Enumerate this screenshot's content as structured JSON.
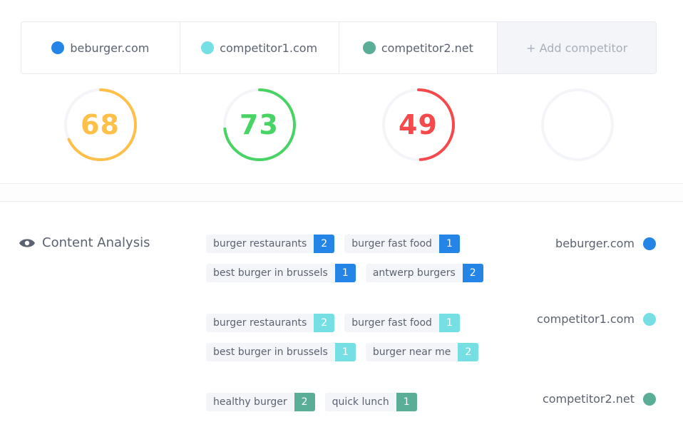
{
  "competitors": [
    {
      "name": "beburger.com",
      "color": "#2585e6",
      "score": 68,
      "score_color": "#ffc04a"
    },
    {
      "name": "competitor1.com",
      "color": "#75dfe4",
      "score": 73,
      "score_color": "#48d465"
    },
    {
      "name": "competitor2.net",
      "color": "#5aad96",
      "score": 49,
      "score_color": "#f5494b"
    }
  ],
  "add_competitor_label": "+ Add competitor",
  "gauge_track_color": "#f4f5f9",
  "content_analysis": {
    "title": "Content Analysis",
    "icon": "eye-icon",
    "groups": [
      {
        "site": "beburger.com",
        "color": "#2585e6",
        "rows": [
          [
            {
              "keyword": "burger restaurants",
              "count": "2"
            },
            {
              "keyword": "burger fast food",
              "count": "1"
            }
          ],
          [
            {
              "keyword": "best burger in brussels",
              "count": "1"
            },
            {
              "keyword": "antwerp burgers",
              "count": "2"
            }
          ]
        ]
      },
      {
        "site": "competitor1.com",
        "color": "#75dfe4",
        "rows": [
          [
            {
              "keyword": "burger restaurants",
              "count": "2"
            },
            {
              "keyword": "burger fast food",
              "count": "1"
            }
          ],
          [
            {
              "keyword": "best burger in brussels",
              "count": "1"
            },
            {
              "keyword": "burger near me",
              "count": "2"
            }
          ]
        ]
      },
      {
        "site": "competitor2.net",
        "color": "#5aad96",
        "rows": [
          [
            {
              "keyword": "healthy burger",
              "count": "2"
            },
            {
              "keyword": "quick lunch",
              "count": "1"
            }
          ]
        ]
      }
    ]
  }
}
